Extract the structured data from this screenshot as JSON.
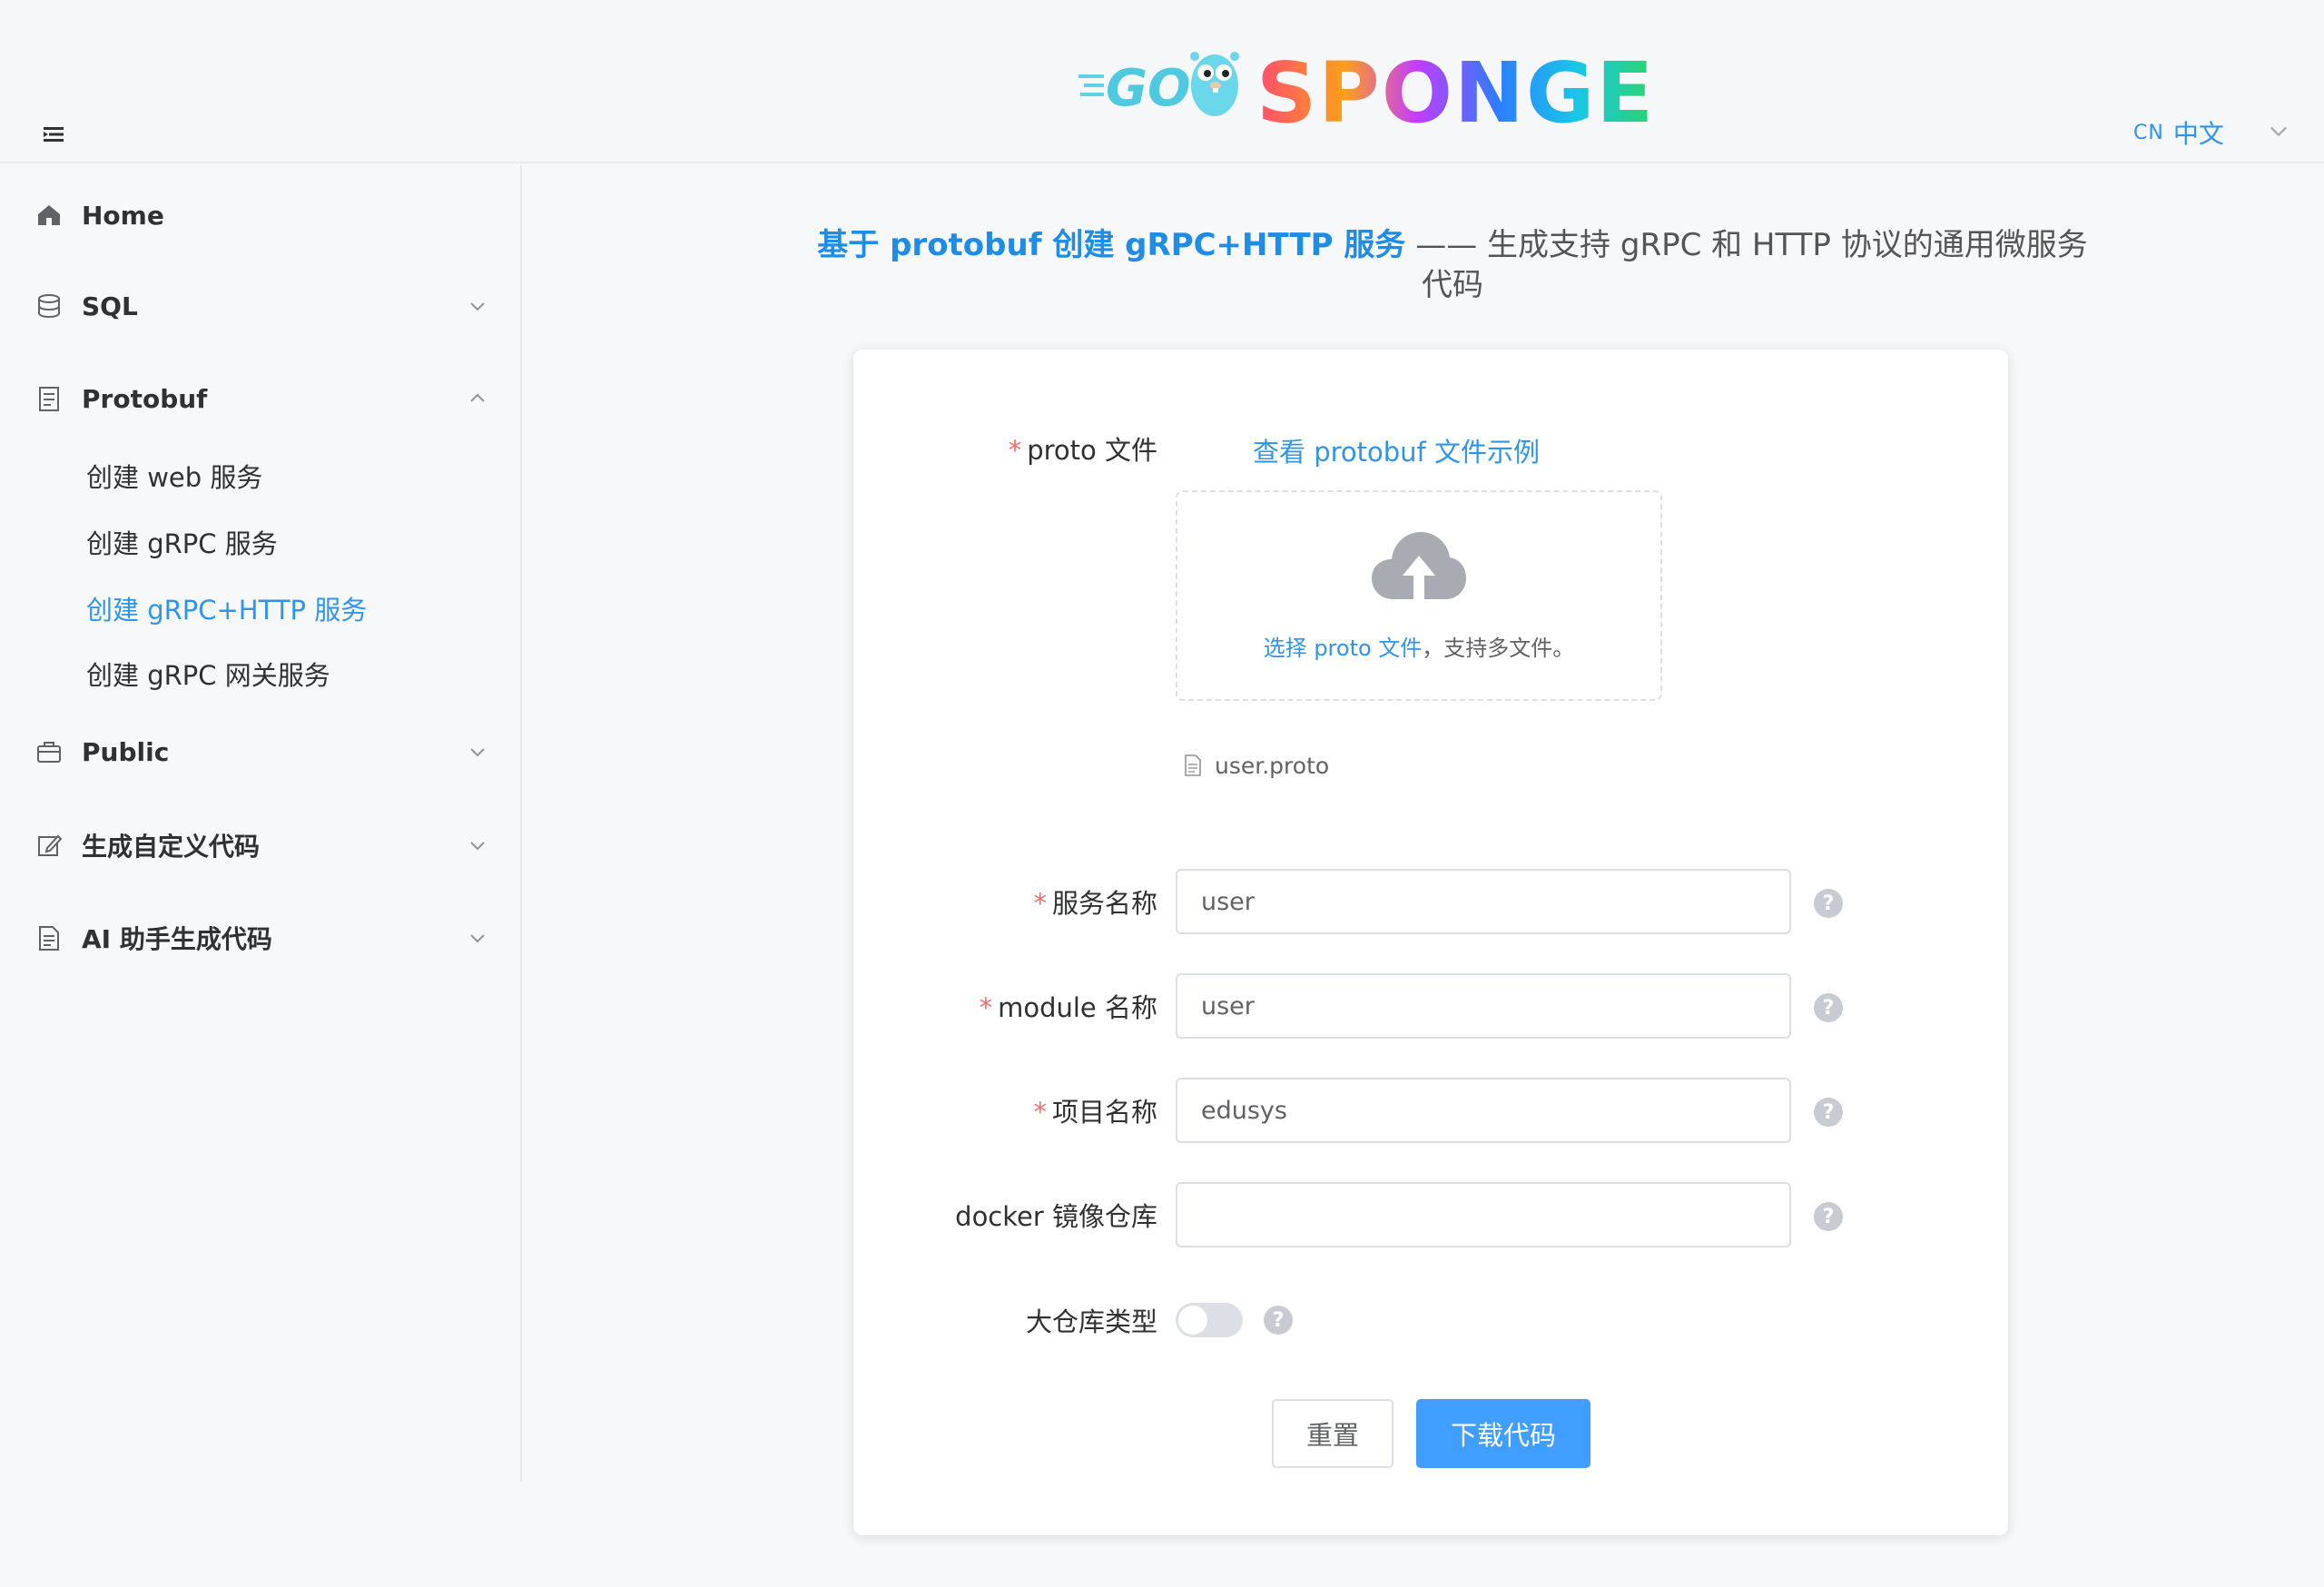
{
  "header": {
    "logo_go": "GO",
    "logo_sponge": "SPONGE",
    "lang_code": "CN",
    "lang_label": "中文"
  },
  "sidebar": {
    "items": [
      {
        "label": "Home",
        "icon": "home-icon"
      },
      {
        "label": "SQL",
        "icon": "database-icon"
      },
      {
        "label": "Protobuf",
        "icon": "document-icon"
      },
      {
        "label": "Public",
        "icon": "briefcase-icon"
      },
      {
        "label": "生成自定义代码",
        "icon": "edit-icon"
      },
      {
        "label": "AI 助手生成代码",
        "icon": "document-icon"
      }
    ],
    "protobuf_children": [
      {
        "label": "创建 web 服务"
      },
      {
        "label": "创建 gRPC 服务"
      },
      {
        "label": "创建 gRPC+HTTP 服务",
        "active": true
      },
      {
        "label": "创建 gRPC 网关服务"
      }
    ]
  },
  "main": {
    "title_highlight": "基于 protobuf 创建 gRPC+HTTP 服务",
    "title_rest": " —— 生成支持 gRPC 和 HTTP 协议的通用微服务代码",
    "form": {
      "proto_label": "proto 文件",
      "sample_link": "查看 protobuf 文件示例",
      "upload_select": "选择 proto 文件",
      "upload_hint": "，支持多文件。",
      "file_name": "user.proto",
      "service_label": "服务名称",
      "service_value": "user",
      "module_label": "module 名称",
      "module_value": "user",
      "project_label": "项目名称",
      "project_value": "edusys",
      "docker_label": "docker 镜像仓库",
      "docker_value": "",
      "monorepo_label": "大仓库类型",
      "monorepo_enabled": false,
      "help_glyph": "?",
      "reset_button": "重置",
      "download_button": "下载代码"
    }
  },
  "colors": {
    "accent": "#409eff",
    "link": "#2f95e8",
    "required": "#f56c6c"
  }
}
